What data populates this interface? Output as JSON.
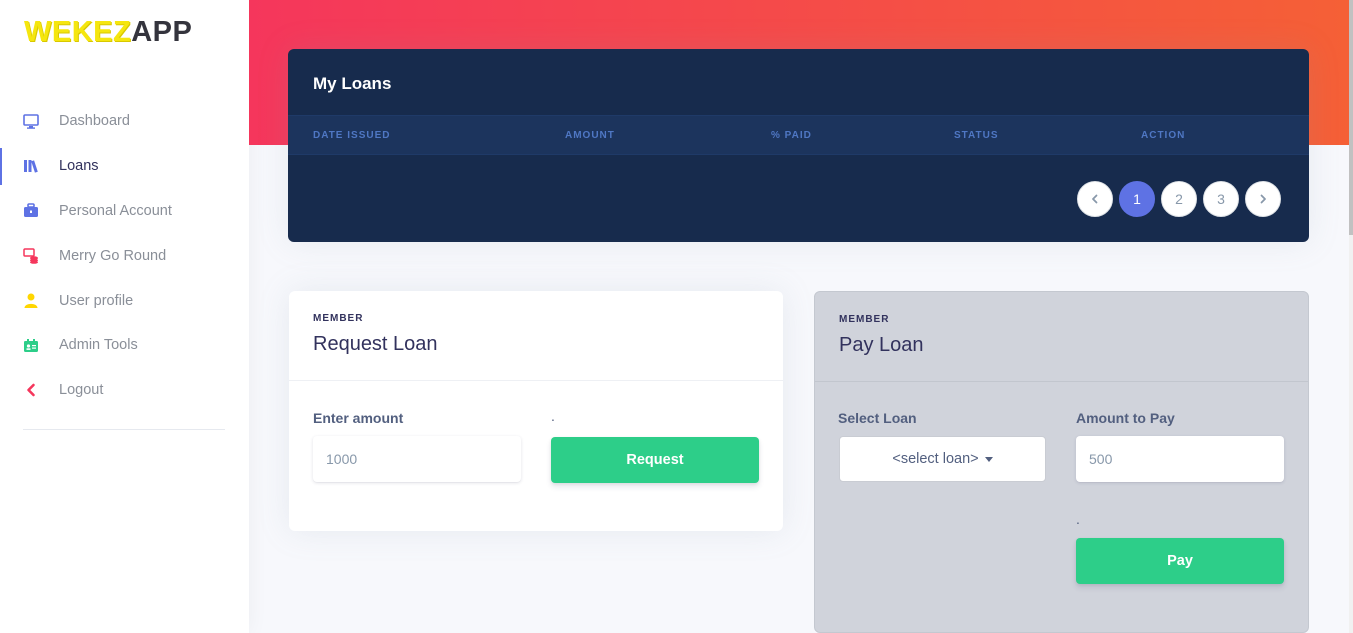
{
  "app": {
    "logo_wekez": "WEKEZ",
    "logo_app": "APP"
  },
  "sidebar": {
    "items": [
      {
        "label": "Dashboard",
        "icon": "monitor-icon",
        "color": "#5e72e4"
      },
      {
        "label": "Loans",
        "icon": "books-icon",
        "color": "#5e72e4",
        "active": true
      },
      {
        "label": "Personal Account",
        "icon": "briefcase-icon",
        "color": "#5e72e4"
      },
      {
        "label": "Merry Go Round",
        "icon": "money-coins-icon",
        "color": "#f5365c"
      },
      {
        "label": "User profile",
        "icon": "user-icon",
        "color": "#ffd600"
      },
      {
        "label": "Admin Tools",
        "icon": "badge-icon",
        "color": "#2dce89"
      },
      {
        "label": "Logout",
        "icon": "chevron-left-icon",
        "color": "#f5365c"
      }
    ]
  },
  "loans": {
    "title": "My Loans",
    "columns": [
      "Date Issued",
      "Amount",
      "% Paid",
      "Status",
      "Action"
    ],
    "pagination": {
      "pages": [
        "1",
        "2",
        "3"
      ],
      "active_page": "1"
    }
  },
  "request_loan": {
    "eyebrow": "Member",
    "title": "Request Loan",
    "amount_label": "Enter amount",
    "amount_placeholder": "1000",
    "spacer": ".",
    "button_label": "Request"
  },
  "pay_loan": {
    "eyebrow": "Member",
    "title": "Pay Loan",
    "select_label": "Select Loan",
    "select_value": "<select loan>",
    "amount_label": "Amount to Pay",
    "amount_placeholder": "500",
    "spacer": ".",
    "button_label": "Pay"
  },
  "colors": {
    "primary": "#5e72e4",
    "success": "#2dce89",
    "header_gradient_start": "#f5365c",
    "header_gradient_end": "#f56036",
    "loans_card_bg": "#172b4d"
  }
}
